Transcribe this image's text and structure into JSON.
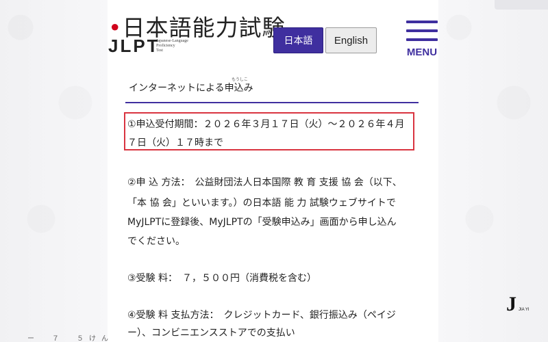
{
  "header": {
    "logo_title": "日本語能力試験",
    "logo_mark": "JLPT",
    "logo_subtitle": "Japanese-Language\nProficiency\nTest",
    "lang_japanese": "日本語",
    "lang_english": "English",
    "menu_label": "MENU"
  },
  "colors": {
    "accent": "#3f2f9f",
    "highlight_border": "#d9333f"
  },
  "content": {
    "section_title": "インターネットによる申込み",
    "section_title_furigana": "もうしこ",
    "item1_line1": "①申込受付期間：２０２６年３月１７日（火）～２０２６年４月",
    "item1_line2": "７日（火）１７時まで",
    "item2_line1": "②申 込 方法：　公益財団法人日本国際 教 育 支援 協 会（以下、",
    "item2_line2": "「本 協 会」といいます。）の日本語 能 力 試験ウェブサイトで",
    "item2_line3": "MyJLPTに登録後、MyJLPTの「受験申込み」画面から申し込ん",
    "item2_line4": "でください。",
    "item3": "③受験 料：　７，５００円（消費税を含む）",
    "item4_line1": "④受験 料 支払方法：　クレジットカード、銀行振込み（ペイジ",
    "item4_line2": "ー）、コンビニエンスストアでの支払い"
  },
  "watermark": {
    "mark": "J",
    "text": "JIA YI"
  },
  "bottom_fragment": "ー　７　５けん"
}
